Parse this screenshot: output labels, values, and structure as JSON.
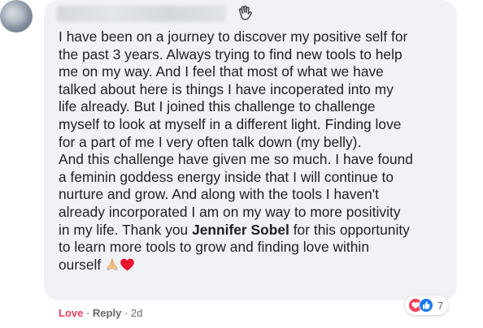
{
  "comment": {
    "author_icon": "waving-hand-icon",
    "text_before_mention": "I have been on a journey to discover my positive self for\nthe past 3 years. Always trying to find new tools to help\nme on my way. And I feel that most of what we have\ntalked about here is things I have incoperated into my\nlife already. But I joined this challenge to challenge\nmyself to look at myself in a different light. Finding love\nfor a part of me I very often talk down (my belly).\nAnd this challenge have given me so much. I have found\na feminin goddess energy inside that I will continue to\nnurture and grow. And along with the tools I haven't\nalready incorporated I am on my way to more positivity\nin my life. Thank you ",
    "mention": "Jennifer Sobel",
    "text_after_mention": " for this opportunity\nto learn more tools to grow and finding love within\nourself ",
    "emojis": [
      "folded-hands-icon",
      "red-heart-icon"
    ]
  },
  "actions": {
    "love_label": "Love",
    "separator": " · ",
    "reply_label": "Reply",
    "time": "2d"
  },
  "reactions": {
    "icons": [
      "love-reaction-icon",
      "like-reaction-icon"
    ],
    "count": "7"
  },
  "colors": {
    "bubble": "#f0f2f5",
    "love": "#e4405f",
    "like": "#1877f2",
    "meta": "#65676b"
  }
}
